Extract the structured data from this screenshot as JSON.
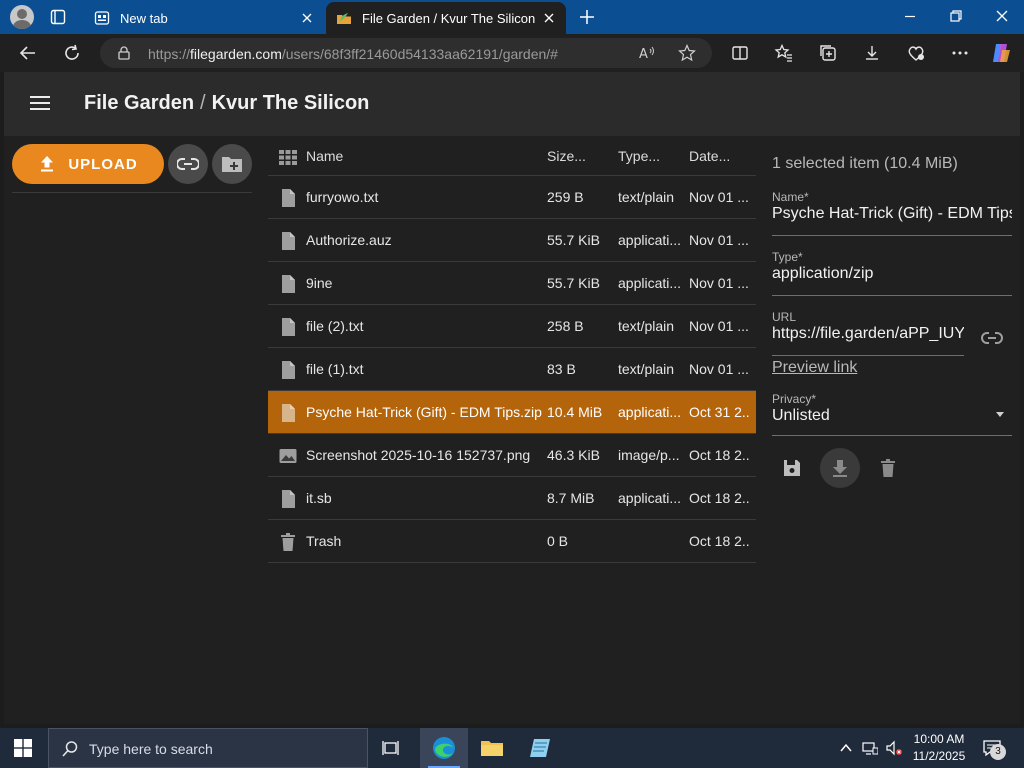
{
  "browser": {
    "tabs": [
      {
        "title": "New tab",
        "active": false
      },
      {
        "title": "File Garden / Kvur The Silicon",
        "active": true
      }
    ],
    "url": {
      "scheme": "https://",
      "host": "filegarden.com",
      "path": "/users/68f3ff21460d54133aa62191/garden/#"
    }
  },
  "app": {
    "title": "File Garden",
    "breadcrumb_sep": "/",
    "user": "Kvur The Silicon",
    "upload_label": "UPLOAD",
    "accent": "#e8881e",
    "selected_row": "#b4640a"
  },
  "table": {
    "headers": {
      "name": "Name",
      "size": "Size...",
      "type": "Type...",
      "date": "Date..."
    },
    "rows": [
      {
        "icon": "file-icon",
        "name": "furryowo.txt",
        "size": "259 B",
        "type": "text/plain",
        "date": "Nov 01 ..."
      },
      {
        "icon": "file-icon",
        "name": "Authorize.auz",
        "size": "55.7 KiB",
        "type": "applicati...",
        "date": "Nov 01 ..."
      },
      {
        "icon": "file-icon",
        "name": "9ine",
        "size": "55.7 KiB",
        "type": "applicati...",
        "date": "Nov 01 ..."
      },
      {
        "icon": "file-icon",
        "name": "file (2).txt",
        "size": "258 B",
        "type": "text/plain",
        "date": "Nov 01 ..."
      },
      {
        "icon": "file-icon",
        "name": "file (1).txt",
        "size": "83 B",
        "type": "text/plain",
        "date": "Nov 01 ..."
      },
      {
        "icon": "file-icon",
        "name": "Psyche Hat-Trick (Gift) - EDM Tips.zip",
        "size": "10.4 MiB",
        "type": "applicati...",
        "date": "Oct 31 2..."
      },
      {
        "icon": "image-icon",
        "name": "Screenshot 2025-10-16 152737.png",
        "size": "46.3 KiB",
        "type": "image/p...",
        "date": "Oct 18 2..."
      },
      {
        "icon": "file-icon",
        "name": "it.sb",
        "size": "8.7 MiB",
        "type": "applicati...",
        "date": "Oct 18 2..."
      },
      {
        "icon": "trash-icon",
        "name": "Trash",
        "size": "0 B",
        "type": "",
        "date": "Oct 18 2..."
      }
    ]
  },
  "detail": {
    "selection": "1 selected item (10.4 MiB)",
    "name_label": "Name*",
    "name_value": "Psyche Hat-Trick (Gift) - EDM Tips.zip",
    "type_label": "Type*",
    "type_value": "application/zip",
    "url_label": "URL",
    "url_value": "https://file.garden/aPP_IUY",
    "preview_link": "Preview link",
    "privacy_label": "Privacy*",
    "privacy_value": "Unlisted"
  },
  "taskbar": {
    "search_placeholder": "Type here to search",
    "time": "10:00 AM",
    "date": "11/2/2025",
    "notifications": "3"
  }
}
